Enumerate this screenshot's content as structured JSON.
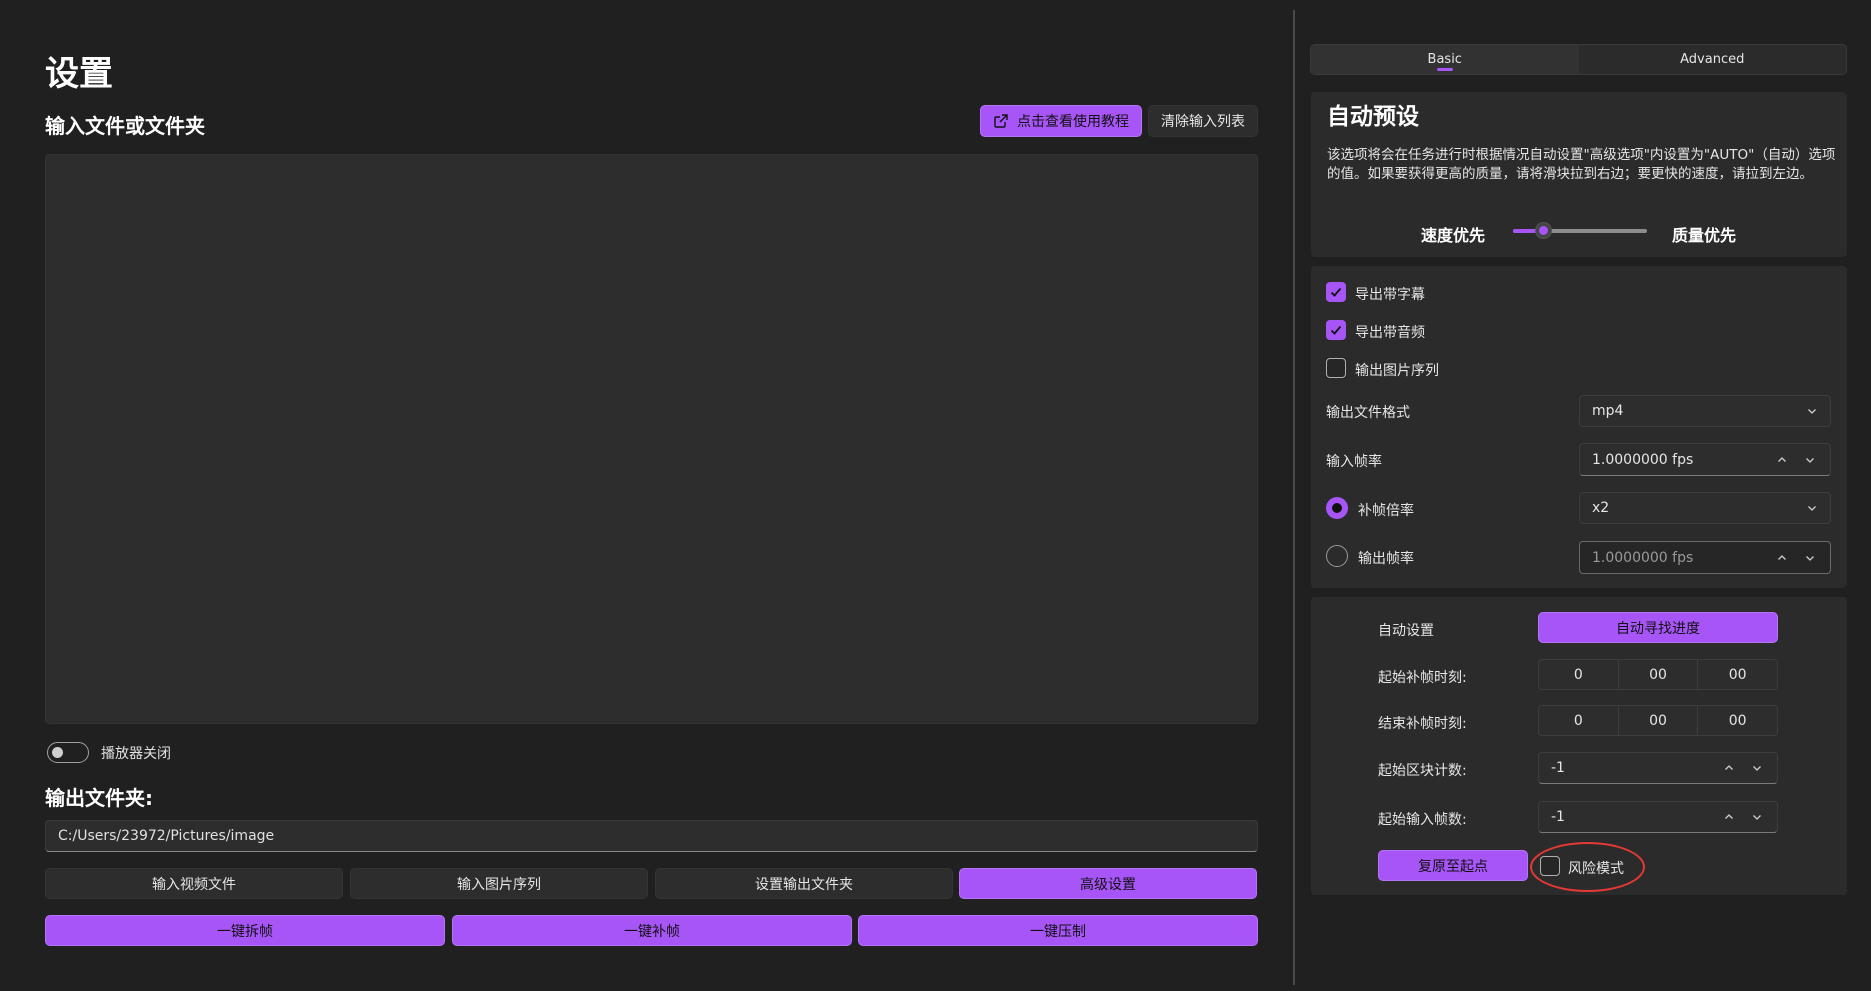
{
  "left": {
    "page_title": "设置",
    "input_section_title": "输入文件或文件夹",
    "tutorial_button": "点击查看使用教程",
    "clear_button": "清除输入列表",
    "player_toggle_label": "播放器关闭",
    "output_section_title": "输出文件夹:",
    "output_path": "C:/Users/23972/Pictures/image",
    "buttons_row1": [
      "输入视频文件",
      "输入图片序列",
      "设置输出文件夹",
      "高级设置"
    ],
    "buttons_row2": [
      "一键拆帧",
      "一键补帧",
      "一键压制"
    ]
  },
  "right": {
    "tabs": [
      {
        "label": "Basic",
        "active": true
      },
      {
        "label": "Advanced",
        "active": false
      }
    ],
    "preset": {
      "title": "自动预设",
      "description": "该选项将会在任务进行时根据情况自动设置\"高级选项\"内设置为\"AUTO\"（自动）选项的值。如果要获得更高的质量，请将滑块拉到右边；要更快的速度，请拉到左边。",
      "speed_label": "速度优先",
      "quality_label": "质量优先",
      "slider_level": 0.2
    },
    "options": {
      "export_subtitles": {
        "label": "导出带字幕",
        "checked": true
      },
      "export_audio": {
        "label": "导出带音频",
        "checked": true
      },
      "export_image_seq": {
        "label": "输出图片序列",
        "checked": false
      },
      "output_format_label": "输出文件格式",
      "output_format_value": "mp4",
      "input_fps_label": "输入帧率",
      "input_fps_value": "1.0000000 fps",
      "interp_ratio_label": "补帧倍率",
      "interp_ratio_value": "x2",
      "output_fps_label": "输出帧率",
      "output_fps_value": "1.0000000 fps"
    },
    "progress": {
      "auto_label": "自动设置",
      "auto_button": "自动寻找进度",
      "start_time_label": "起始补帧时刻:",
      "start_time": [
        "0",
        "00",
        "00"
      ],
      "end_time_label": "结束补帧时刻:",
      "end_time": [
        "0",
        "00",
        "00"
      ],
      "start_chunk_label": "起始区块计数:",
      "start_chunk_value": "-1",
      "start_frame_label": "起始输入帧数:",
      "start_frame_value": "-1",
      "reset_button": "复原至起点",
      "risk_mode_label": "风险模式",
      "risk_mode_checked": false
    }
  },
  "colors": {
    "accent": "#a855f7",
    "background": "#202020",
    "card": "#2b2b2b",
    "annotation": "#e53935"
  }
}
